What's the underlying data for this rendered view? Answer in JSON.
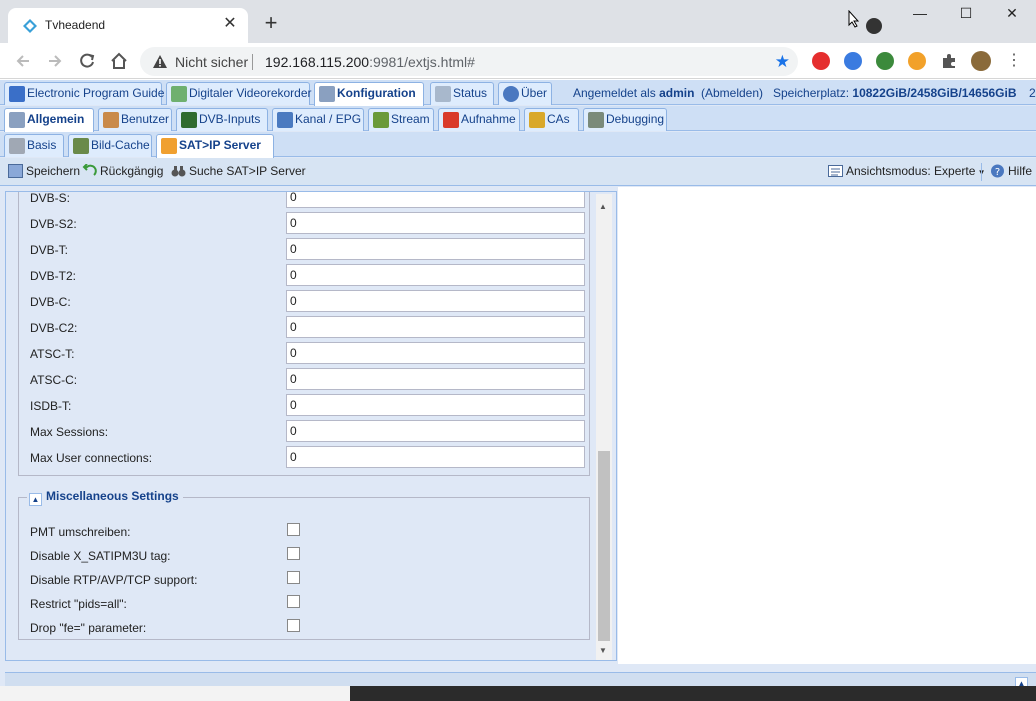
{
  "browser": {
    "tab_title": "Tvheadend",
    "security_label": "Nicht sicher",
    "url_host": "192.168.115.200",
    "url_rest": ":9981/extjs.html#"
  },
  "top_tabs": [
    {
      "label": "Electronic Program Guide",
      "icon": "epg-icon"
    },
    {
      "label": "Digitaler Videorekorder",
      "icon": "dvr-icon"
    },
    {
      "label": "Konfiguration",
      "icon": "wrench-icon",
      "active": true
    },
    {
      "label": "Status",
      "icon": "eye-icon"
    },
    {
      "label": "Über",
      "icon": "info-icon"
    }
  ],
  "header": {
    "logged_in_prefix": "Angemeldet als",
    "user": "admin",
    "logout": "(Abmelden)",
    "storage_label": "Speicherplatz:",
    "storage_value": "10822GiB/2458GiB/14656GiB",
    "overflow": "2"
  },
  "second_tabs": [
    {
      "label": "Allgemein",
      "active": true
    },
    {
      "label": "Benutzer"
    },
    {
      "label": "DVB-Inputs"
    },
    {
      "label": "Kanal / EPG"
    },
    {
      "label": "Stream"
    },
    {
      "label": "Aufnahme"
    },
    {
      "label": "CAs"
    },
    {
      "label": "Debugging"
    }
  ],
  "third_tabs": [
    {
      "label": "Basis"
    },
    {
      "label": "Bild-Cache"
    },
    {
      "label": "SAT>IP Server",
      "active": true
    }
  ],
  "toolbar": {
    "save": "Speichern",
    "undo": "Rückgängig",
    "search_server": "Suche SAT>IP Server",
    "view_mode": "Ansichtsmodus: Experte",
    "help": "Hilfe"
  },
  "fields": [
    {
      "label": "DVB-S:",
      "value": "0"
    },
    {
      "label": "DVB-S2:",
      "value": "0"
    },
    {
      "label": "DVB-T:",
      "value": "0"
    },
    {
      "label": "DVB-T2:",
      "value": "0"
    },
    {
      "label": "DVB-C:",
      "value": "0"
    },
    {
      "label": "DVB-C2:",
      "value": "0"
    },
    {
      "label": "ATSC-T:",
      "value": "0"
    },
    {
      "label": "ATSC-C:",
      "value": "0"
    },
    {
      "label": "ISDB-T:",
      "value": "0"
    },
    {
      "label": "Max Sessions:",
      "value": "0"
    },
    {
      "label": "Max User connections:",
      "value": "0"
    }
  ],
  "misc": {
    "legend": "Miscellaneous Settings",
    "checkboxes": [
      {
        "label": "PMT umschreiben:",
        "checked": false
      },
      {
        "label": "Disable X_SATIPM3U tag:",
        "checked": false
      },
      {
        "label": "Disable RTP/AVP/TCP support:",
        "checked": false
      },
      {
        "label": "Restrict \"pids=all\":",
        "checked": false
      },
      {
        "label": "Drop \"fe=\" parameter:",
        "checked": false
      }
    ]
  },
  "colors": {
    "extjs_bg": "#dfe8f6",
    "tab_text": "#15428b",
    "chrome_bg": "#dee1e6"
  }
}
